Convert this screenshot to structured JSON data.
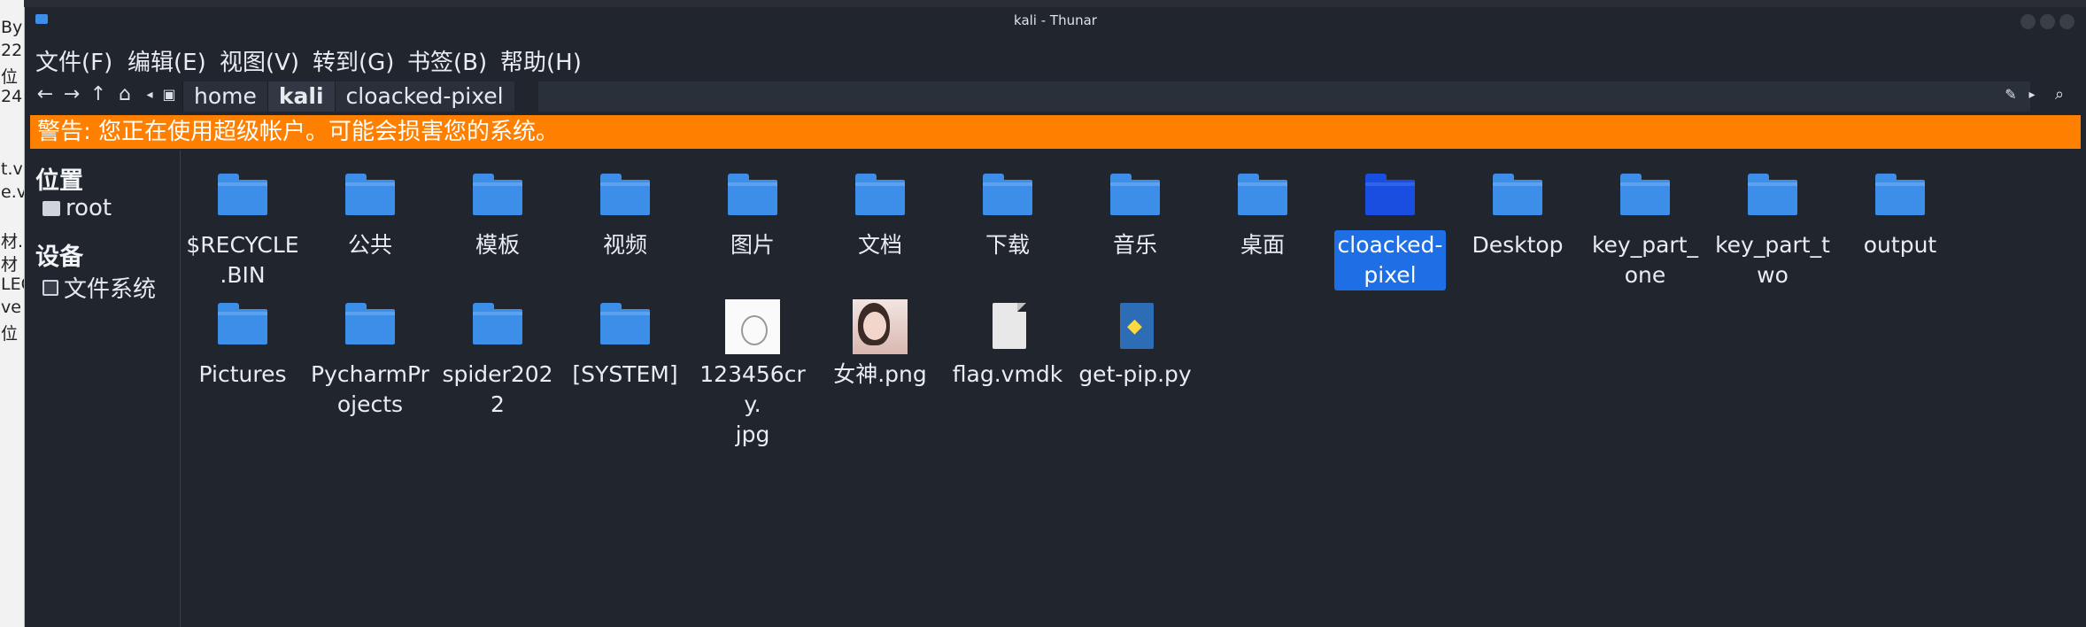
{
  "window": {
    "title": "kali - Thunar"
  },
  "background_fragments": [
    "By",
    "22",
    "位",
    "24",
    "t.v",
    "e.vi",
    "材.",
    "材",
    "LEO",
    "ve",
    "位"
  ],
  "menu": [
    "文件(F)",
    "编辑(E)",
    "视图(V)",
    "转到(G)",
    "书签(B)",
    "帮助(H)"
  ],
  "path": [
    "home",
    "kali",
    "cloacked-pixel"
  ],
  "warning": "警告: 您正在使用超级帐户。可能会损害您的系统。",
  "sidebar": {
    "places_header": "位置",
    "places": [
      "root"
    ],
    "devices_header": "设备",
    "devices": [
      "文件系统"
    ]
  },
  "items": [
    {
      "name": "$RECYCLE.BIN",
      "line1": "$RECYCLE",
      "line2": ".BIN",
      "kind": "folder"
    },
    {
      "name": "公共",
      "line1": "公共",
      "line2": "",
      "kind": "folder"
    },
    {
      "name": "模板",
      "line1": "模板",
      "line2": "",
      "kind": "folder"
    },
    {
      "name": "视频",
      "line1": "视频",
      "line2": "",
      "kind": "folder"
    },
    {
      "name": "图片",
      "line1": "图片",
      "line2": "",
      "kind": "folder"
    },
    {
      "name": "文档",
      "line1": "文档",
      "line2": "",
      "kind": "folder"
    },
    {
      "name": "下载",
      "line1": "下载",
      "line2": "",
      "kind": "folder"
    },
    {
      "name": "音乐",
      "line1": "音乐",
      "line2": "",
      "kind": "folder"
    },
    {
      "name": "桌面",
      "line1": "桌面",
      "line2": "",
      "kind": "folder"
    },
    {
      "name": "cloacked-pixel",
      "line1": "cloacked-",
      "line2": "pixel",
      "kind": "folder",
      "selected": true
    },
    {
      "name": "Desktop",
      "line1": "Desktop",
      "line2": "",
      "kind": "folder"
    },
    {
      "name": "key_part_one",
      "line1": "key_part_",
      "line2": "one",
      "kind": "folder"
    },
    {
      "name": "key_part_two",
      "line1": "key_part_t",
      "line2": "wo",
      "kind": "folder"
    },
    {
      "name": "output",
      "line1": "output",
      "line2": "",
      "kind": "folder"
    },
    {
      "name": "Pictures",
      "line1": "Pictures",
      "line2": "",
      "kind": "folder"
    },
    {
      "name": "PycharmProjects",
      "line1": "PycharmPr",
      "line2": "ojects",
      "kind": "folder"
    },
    {
      "name": "spider2022",
      "line1": "spider202",
      "line2": "2",
      "kind": "folder"
    },
    {
      "name": "[SYSTEM]",
      "line1": "[SYSTEM]",
      "line2": "",
      "kind": "folder"
    },
    {
      "name": "123456cry.jpg",
      "line1": "123456cry.",
      "line2": "jpg",
      "kind": "image"
    },
    {
      "name": "女神.png",
      "line1": "女神.png",
      "line2": "",
      "kind": "photo"
    },
    {
      "name": "flag.vmdk",
      "line1": "flag.vmdk",
      "line2": "",
      "kind": "file"
    },
    {
      "name": "get-pip.py",
      "line1": "get-pip.py",
      "line2": "",
      "kind": "python"
    }
  ],
  "colors": {
    "warning_bg": "#ff7f00",
    "folder": "#3d8ee8",
    "selection": "#1e6fe6",
    "window_bg": "#20252e"
  }
}
